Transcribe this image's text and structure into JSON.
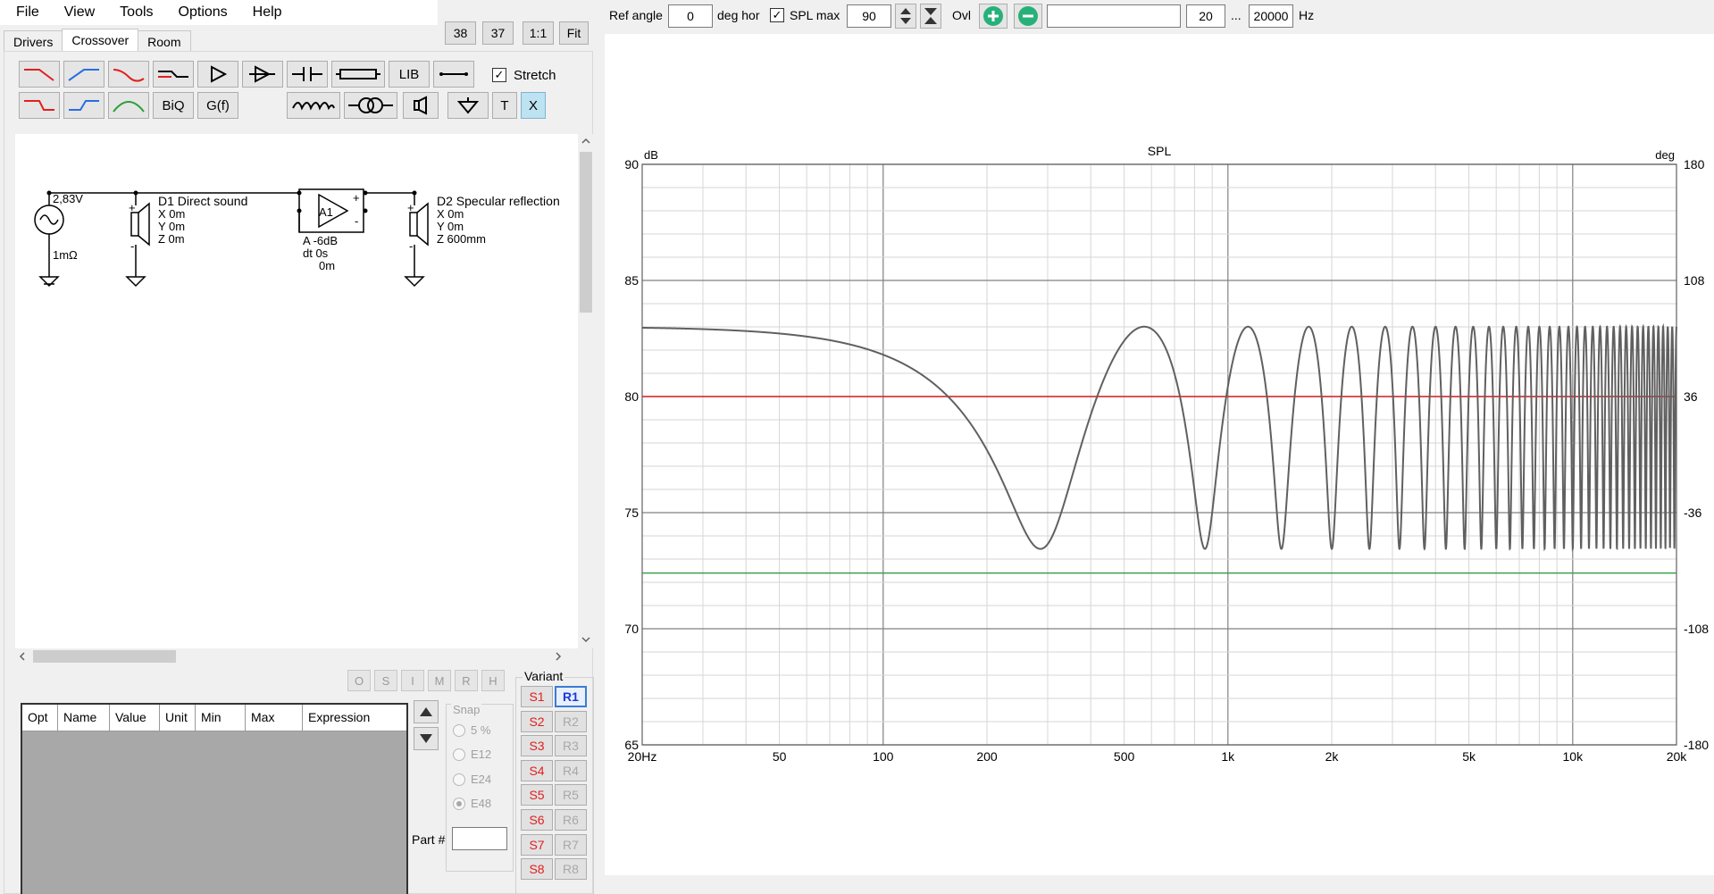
{
  "menu": [
    "File",
    "View",
    "Tools",
    "Options",
    "Help"
  ],
  "tabs": [
    "Drivers",
    "Crossover",
    "Room"
  ],
  "top_buttons": [
    "38",
    "37",
    "1:1",
    "Fit"
  ],
  "toolbar": {
    "lib": "LIB",
    "biq": "BiQ",
    "gf": "G(f)",
    "t": "T",
    "x": "X",
    "stretch_label": "Stretch",
    "stretch_checked": "✓"
  },
  "schematic": {
    "source_voltage": "2,83V",
    "source_res": "1mΩ",
    "d1_name": "D1 Direct sound",
    "d1_x": "X 0m",
    "d1_y": "Y 0m",
    "d1_z": "Z 0m",
    "amp_name": "A1",
    "amp_gain": "A -6dB",
    "amp_dt": "dt 0s",
    "amp_dist": "0m",
    "d2_name": "D2 Specular reflection",
    "d2_x": "X 0m",
    "d2_y": "Y 0m",
    "d2_z": "Z 600mm",
    "plus": "+",
    "minus": "-"
  },
  "opt_buttons": [
    "O",
    "S",
    "I",
    "M",
    "R",
    "H"
  ],
  "table_headers": [
    "Opt",
    "Name",
    "Value",
    "Unit",
    "Min",
    "Max",
    "Expression"
  ],
  "snap": {
    "label": "Snap",
    "options": [
      "5 %",
      "E12",
      "E24",
      "E48"
    ],
    "selected": "E48"
  },
  "part_label": "Part #",
  "variant": {
    "label": "Variant",
    "s": [
      "S1",
      "S2",
      "S3",
      "S4",
      "S5",
      "S6",
      "S7",
      "S8"
    ],
    "r": [
      "R1",
      "R2",
      "R3",
      "R4",
      "R5",
      "R6",
      "R7",
      "R8"
    ],
    "active": "R1"
  },
  "top_controls": {
    "ref_angle_label": "Ref angle",
    "ref_angle_value": "0",
    "deg_hor": "deg hor",
    "spl_max_label": "SPL max",
    "spl_max_checked": "✓",
    "spl_max_value": "90",
    "ovl_label": "Ovl",
    "text_field": "",
    "fmin": "20",
    "ellipsis": "...",
    "fmax": "20000",
    "hz": "Hz"
  },
  "colors": {
    "spl_curve": "#606060",
    "red_line": "#d9252a",
    "green_line": "#3aa14a",
    "plus_btn": "#27b07a"
  },
  "chart_data": {
    "type": "line",
    "title": "SPL",
    "ylabel_left": "dB",
    "ylabel_right": "deg",
    "xscale": "log",
    "xlim": [
      20,
      20000
    ],
    "ylim": [
      65,
      90
    ],
    "y2lim": [
      -180,
      180
    ],
    "x_ticks": [
      {
        "v": 20,
        "label": "20Hz"
      },
      {
        "v": 50,
        "label": "50"
      },
      {
        "v": 100,
        "label": "100"
      },
      {
        "v": 200,
        "label": "200"
      },
      {
        "v": 500,
        "label": "500"
      },
      {
        "v": 1000,
        "label": "1k"
      },
      {
        "v": 2000,
        "label": "2k"
      },
      {
        "v": 5000,
        "label": "5k"
      },
      {
        "v": 10000,
        "label": "10k"
      },
      {
        "v": 20000,
        "label": "20k"
      }
    ],
    "y_ticks": [
      90,
      85,
      80,
      75,
      70,
      65
    ],
    "y2_ticks": [
      180,
      108,
      36,
      -36,
      -108,
      -180
    ],
    "reference_lines": [
      {
        "color": "red",
        "y": 80
      },
      {
        "color": "green",
        "y": 72.4
      }
    ],
    "series": [
      {
        "model": "direct plus reflection at -6 dB, delay 1.7493 ms, level 83 dB at low frequency",
        "base_level_db": 79.48,
        "reflection_gain": 0.5012,
        "delay_s": 0.0017493
      }
    ],
    "grid": true
  }
}
